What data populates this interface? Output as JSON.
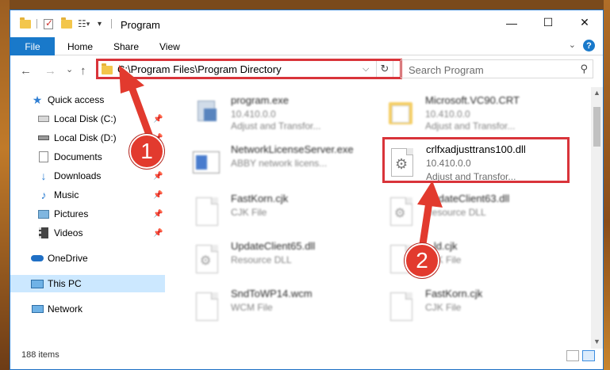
{
  "window": {
    "title": "Program",
    "minimize_glyph": "—",
    "maximize_glyph": "☐",
    "close_glyph": "✕"
  },
  "ribbon": {
    "file_tab": "File",
    "tabs": [
      "Home",
      "Share",
      "View"
    ],
    "help_glyph": "?"
  },
  "address": {
    "path": "C:\\Program Files\\Program Directory",
    "dropdown_glyph": "⌵",
    "refresh_glyph": "↻"
  },
  "search": {
    "placeholder": "Search Program",
    "icon": "search-icon"
  },
  "nav": {
    "back_glyph": "←",
    "forward_glyph": "→",
    "recent_glyph": "⌄",
    "up_glyph": "↑",
    "items": [
      {
        "label": "Quick access",
        "icon": "star-icon",
        "pinned": false
      },
      {
        "label": "Local Disk (C:)",
        "icon": "drive-icon",
        "pinned": true
      },
      {
        "label": "Local Disk (D:)",
        "icon": "drive-icon",
        "pinned": true
      },
      {
        "label": "Documents",
        "icon": "documents-icon",
        "pinned": true
      },
      {
        "label": "Downloads",
        "icon": "downloads-icon",
        "pinned": true
      },
      {
        "label": "Music",
        "icon": "music-icon",
        "pinned": true
      },
      {
        "label": "Pictures",
        "icon": "pictures-icon",
        "pinned": true
      },
      {
        "label": "Videos",
        "icon": "videos-icon",
        "pinned": true
      },
      {
        "label": "OneDrive",
        "icon": "cloud-icon",
        "pinned": false
      },
      {
        "label": "This PC",
        "icon": "computer-icon",
        "pinned": false,
        "selected": true
      },
      {
        "label": "Network",
        "icon": "network-icon",
        "pinned": false
      }
    ]
  },
  "files": [
    {
      "name": "program.exe",
      "line1": "10.410.0.0",
      "line2": "Adjust and Transfor...",
      "icon": "setup-icon"
    },
    {
      "name": "Microsoft.VC90.CRT",
      "line1": "10.410.0.0",
      "line2": "Adjust and Transfor...",
      "icon": "folder-icon"
    },
    {
      "name": "NetworkLicenseServer.exe",
      "line1": "ABBY network licens...",
      "line2": "",
      "icon": "window-icon"
    },
    {
      "name": "crlfxadjusttrans100.dll",
      "line1": "10.410.0.0",
      "line2": "Adjust and Transfor...",
      "icon": "gear-file-icon",
      "highlighted": true
    },
    {
      "name": "FastKorn.cjk",
      "line1": "CJK File",
      "line2": "",
      "icon": "file-icon"
    },
    {
      "name": "UpdateClient63.dll",
      "line1": "Resource DLL",
      "line2": "",
      "icon": "gear-file-icon"
    },
    {
      "name": "UpdateClient65.dll",
      "line1": "Resource DLL",
      "line2": "",
      "icon": "gear-file-icon"
    },
    {
      "name": "...ld.cjk",
      "line1": "CJK File",
      "line2": "",
      "icon": "file-icon"
    },
    {
      "name": "SndToWP14.wcm",
      "line1": "WCM File",
      "line2": "",
      "icon": "file-icon"
    },
    {
      "name": "FastKorn.cjk",
      "line1": "CJK File",
      "line2": "",
      "icon": "file-icon"
    }
  ],
  "status": {
    "item_count": "188 items"
  },
  "annotations": {
    "step1": "1",
    "step2": "2",
    "color": "#e23a2e"
  }
}
